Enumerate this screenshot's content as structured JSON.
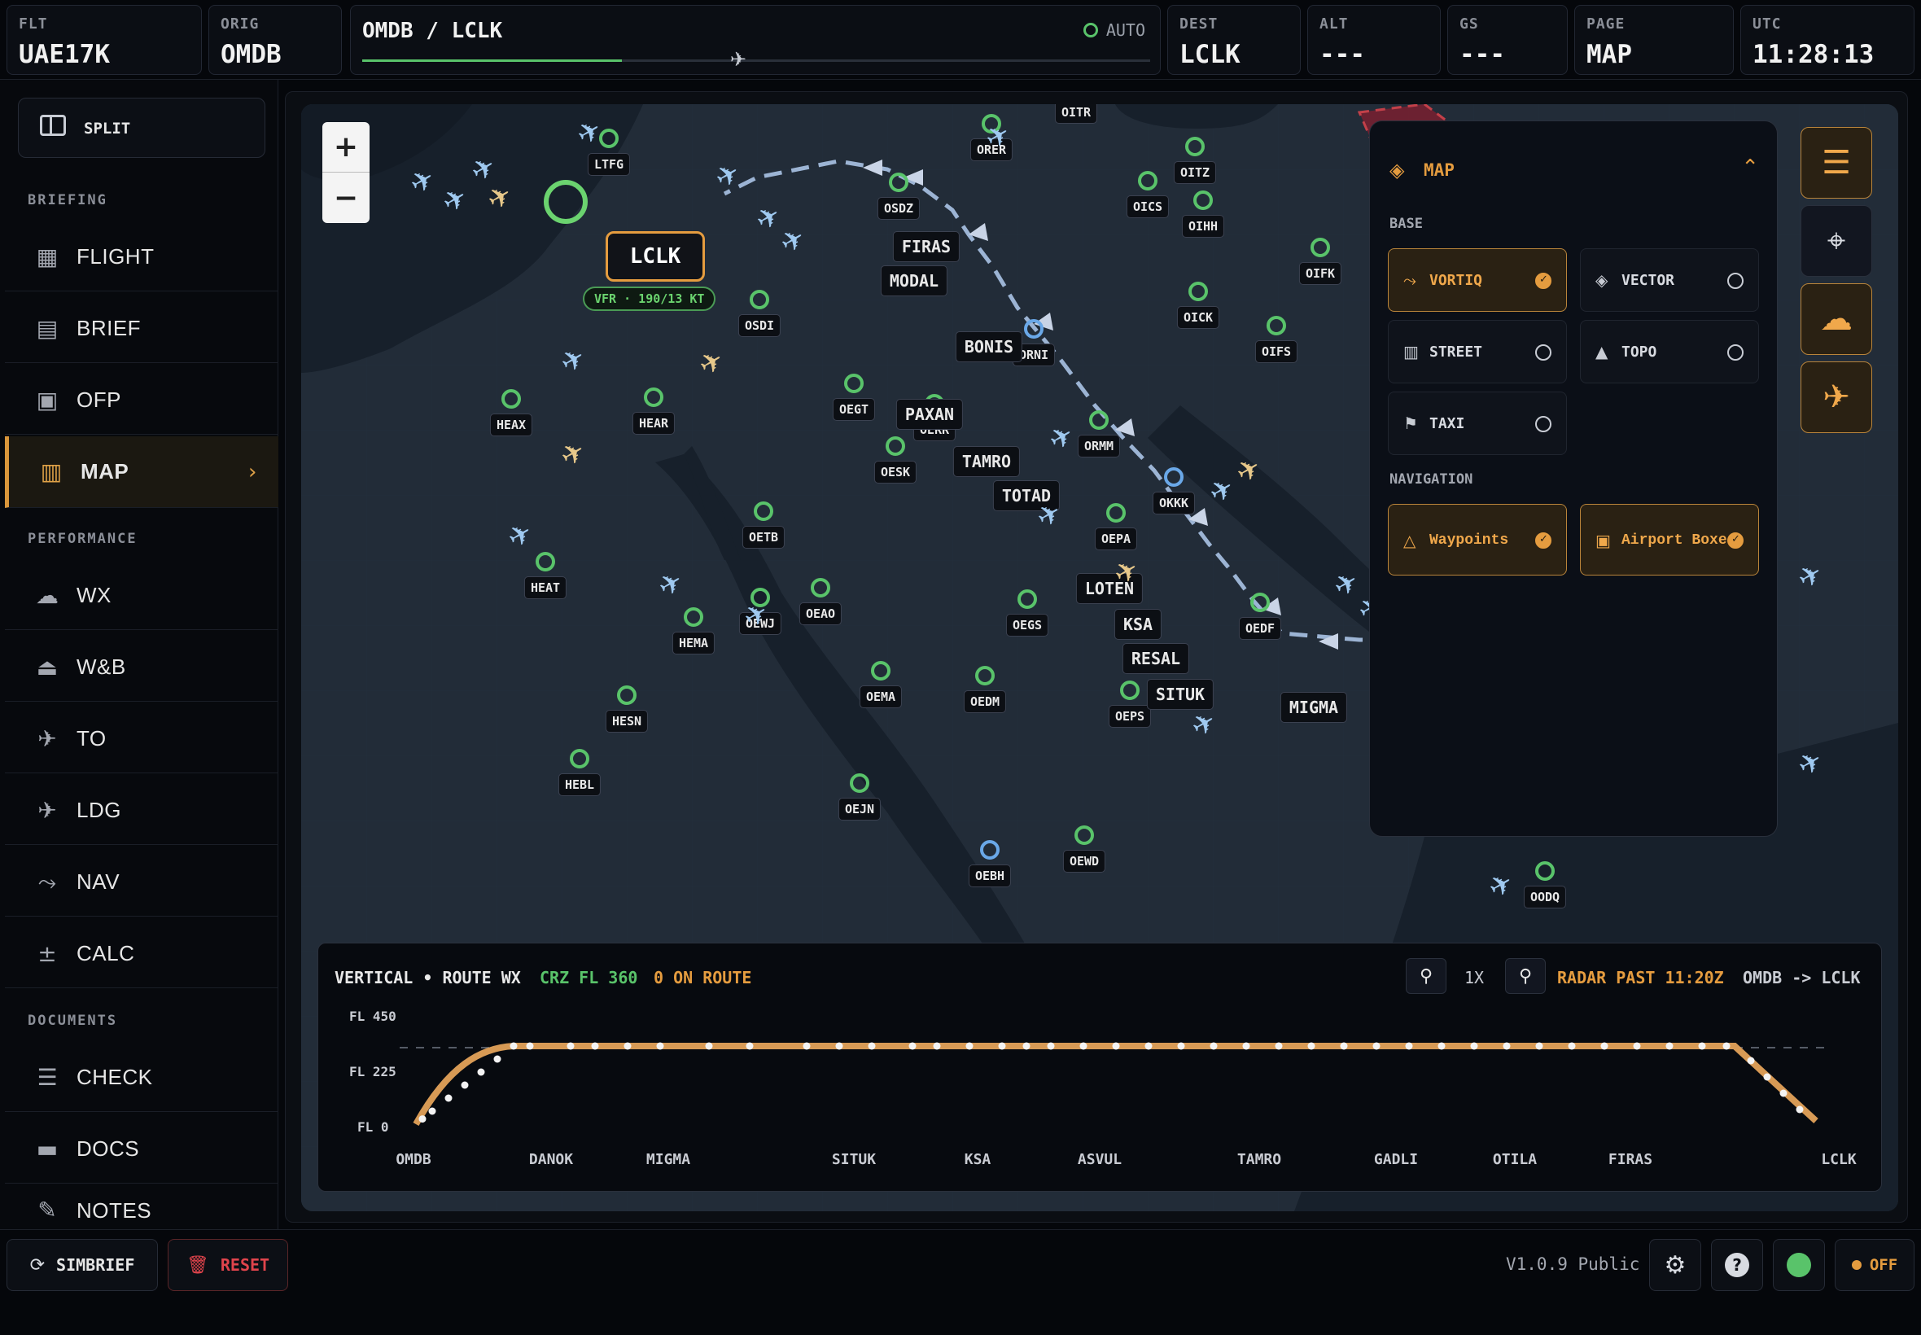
{
  "topbar": {
    "flt": {
      "label": "FLT",
      "value": "UAE17K"
    },
    "orig": {
      "label": "ORIG",
      "value": "OMDB"
    },
    "route": {
      "label": "OMDB / LCLK",
      "mode": "AUTO"
    },
    "dest": {
      "label": "DEST",
      "value": "LCLK"
    },
    "alt": {
      "label": "ALT",
      "value": "---"
    },
    "gs": {
      "label": "GS",
      "value": "---"
    },
    "page": {
      "label": "PAGE",
      "value": "MAP"
    },
    "utc": {
      "label": "UTC",
      "value": "11:28:13"
    }
  },
  "sidebar": {
    "split": "SPLIT",
    "sections": {
      "briefing": "BRIEFING",
      "performance": "PERFORMANCE",
      "documents": "DOCUMENTS"
    },
    "items": [
      {
        "label": "FLIGHT",
        "icon": "grid-icon"
      },
      {
        "label": "BRIEF",
        "icon": "clipboard-icon"
      },
      {
        "label": "OFP",
        "icon": "document-icon"
      },
      {
        "label": "MAP",
        "icon": "map-icon",
        "active": true
      },
      {
        "label": "WX",
        "icon": "weather-icon"
      },
      {
        "label": "W&B",
        "icon": "weight-icon"
      },
      {
        "label": "TO",
        "icon": "takeoff-icon"
      },
      {
        "label": "LDG",
        "icon": "landing-icon"
      },
      {
        "label": "NAV",
        "icon": "route-icon"
      },
      {
        "label": "CALC",
        "icon": "calculator-icon"
      },
      {
        "label": "CHECK",
        "icon": "checklist-icon"
      },
      {
        "label": "DOCS",
        "icon": "folder-icon"
      },
      {
        "label": "NOTES",
        "icon": "pen-icon"
      }
    ]
  },
  "map": {
    "zoom_in": "+",
    "zoom_out": "−",
    "dest_box": {
      "code": "LCLK",
      "info": "VFR · 190/13 KT"
    },
    "airports": [
      "LTFG",
      "OSDZ",
      "ORER",
      "OITR",
      "OITZ",
      "OICS",
      "OIHH",
      "OIFK",
      "OICK",
      "OIFS",
      "ORNI",
      "HEAX",
      "HEAR",
      "OEGT",
      "OERR",
      "OESK",
      "ORMM",
      "OKKK",
      "OEPA",
      "OETB",
      "HEAT",
      "OEAO",
      "OEWJ",
      "HEMA",
      "OEGS",
      "OEDM",
      "OEPS",
      "HESN",
      "OEMA",
      "HEBL",
      "OEJN",
      "OEBH",
      "OEWD",
      "OODQ",
      "OSDI",
      "OEDF"
    ],
    "waypoints": [
      "BONIS",
      "PAXAN",
      "TAMRO",
      "TOTAD",
      "LOTEN",
      "KSA",
      "RESAL",
      "SITUK",
      "MIGMA",
      "FIRAS",
      "MODAL"
    ]
  },
  "panel": {
    "title": "MAP",
    "base_label": "BASE",
    "base_options": [
      {
        "label": "VORTIQ",
        "selected": true
      },
      {
        "label": "VECTOR",
        "selected": false
      },
      {
        "label": "STREET",
        "selected": false
      },
      {
        "label": "TOPO",
        "selected": false
      },
      {
        "label": "TAXI",
        "selected": false
      }
    ],
    "nav_label": "NAVIGATION",
    "nav_options": [
      {
        "label": "Waypoints",
        "selected": true
      },
      {
        "label": "Airport Boxes",
        "selected": true
      }
    ]
  },
  "vprofile": {
    "title": "VERTICAL • ROUTE WX",
    "cruise": "CRZ FL 360",
    "on_route": "0 ON ROUTE",
    "zoom_level": "1X",
    "radar": "RADAR PAST 11:20Z",
    "route": "OMDB -> LCLK",
    "fl_labels": [
      "FL 450",
      "FL 225",
      "FL 0"
    ],
    "waypoints": [
      "OMDB",
      "DANOK",
      "MIGMA",
      "SITUK",
      "KSA",
      "ASVUL",
      "TAMRO",
      "GADLI",
      "OTILA",
      "FIRAS",
      "LCLK"
    ]
  },
  "bottombar": {
    "simbrief": "SIMBRIEF",
    "reset": "RESET",
    "version": "V1.0.9 Public",
    "status": "OFF"
  },
  "colors": {
    "accent": "#e59c3f",
    "bg": "#05070b",
    "panel": "#0b0f17",
    "danger": "#e0444c",
    "green": "#59c36a"
  }
}
